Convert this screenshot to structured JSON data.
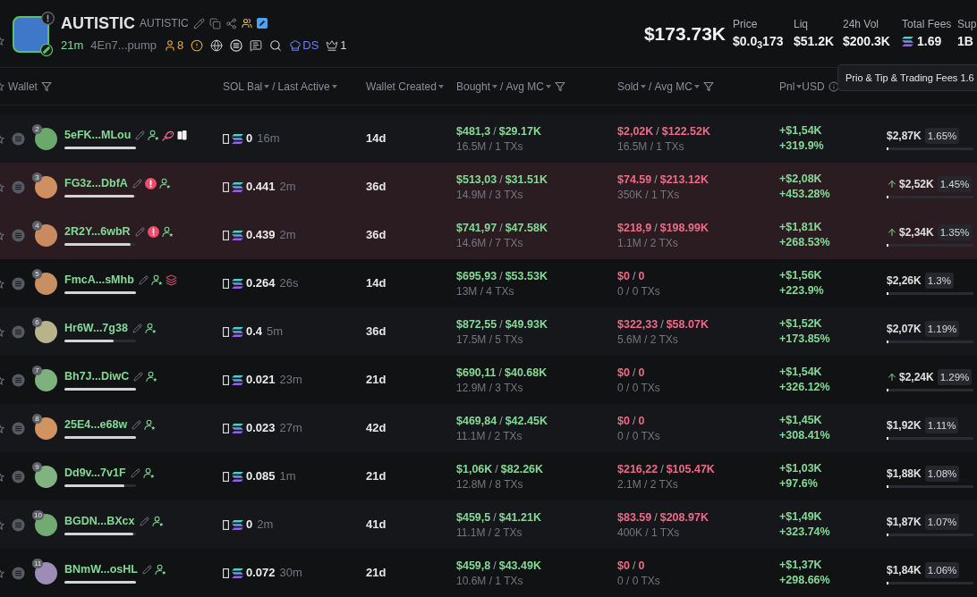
{
  "token": {
    "name": "AUTISTIC",
    "ticker": "AUTISTIC",
    "age": "21m",
    "address": "4En7...pump",
    "holders": "8",
    "dev_label": "DS",
    "crown_count": "1"
  },
  "market_cap": "$173.73K",
  "stats": [
    {
      "label": "Price",
      "value": "$0.0$_{3}$173",
      "kind": "plain"
    },
    {
      "label": "Liq",
      "value": "$51.2K",
      "kind": "plain"
    },
    {
      "label": "24h Vol",
      "value": "$200.3K",
      "kind": "plain"
    },
    {
      "label": "Total Fees",
      "value": "1.69",
      "kind": "sol"
    },
    {
      "label": "Sup",
      "value": "1B",
      "kind": "plain"
    }
  ],
  "tooltip": "Prio & Tip & Trading Fees 1.6",
  "columns": [
    {
      "items": [
        {
          "kind": "label",
          "text": "Wallet"
        },
        {
          "kind": "filter"
        }
      ]
    },
    {
      "items": [
        {
          "kind": "label",
          "text": "SOL Bal"
        },
        {
          "kind": "caret"
        },
        {
          "kind": "separator",
          "text": "/"
        },
        {
          "kind": "label",
          "text": "Last Active"
        },
        {
          "kind": "caret"
        }
      ]
    },
    {
      "items": [
        {
          "kind": "label",
          "text": "Wallet Created"
        },
        {
          "kind": "caret"
        }
      ]
    },
    {
      "items": [
        {
          "kind": "label",
          "text": "Bought"
        },
        {
          "kind": "caret"
        },
        {
          "kind": "separator",
          "text": "/"
        },
        {
          "kind": "label",
          "text": "Avg MC"
        },
        {
          "kind": "caret"
        },
        {
          "kind": "filter"
        }
      ]
    },
    {
      "items": [
        {
          "kind": "label",
          "text": "Sold"
        },
        {
          "kind": "caret"
        },
        {
          "kind": "separator",
          "text": "/"
        },
        {
          "kind": "label",
          "text": "Avg MC"
        },
        {
          "kind": "caret"
        },
        {
          "kind": "filter"
        }
      ]
    },
    {
      "items": [
        {
          "kind": "label",
          "text": "Pnl"
        },
        {
          "kind": "caret"
        },
        {
          "kind": "label",
          "text": "USD"
        },
        {
          "kind": "info"
        }
      ]
    }
  ],
  "rows": [
    {
      "avatar": {
        "rank": "2",
        "color": "#6aa86c"
      },
      "wallet": "5eFK...MLou",
      "tags": [
        {
          "kind": "edit"
        },
        {
          "kind": "tracked"
        },
        {
          "kind": "fish"
        },
        {
          "kind": "cards"
        }
      ],
      "name_bar": {
        "level": 1
      },
      "sol_balance": "0",
      "last_active": "16m",
      "created": "14d",
      "bought": {
        "amount": "$481,3",
        "separator": "/",
        "avg_mc": "$29.17K",
        "detail": "16.5M / 1 TXs"
      },
      "sold": {
        "amount": "$2,02K",
        "separator": "/",
        "avg_mc": "$122.52K",
        "detail": "16.5M / 1 TXs"
      },
      "pnl": {
        "usd": "+$1,54K",
        "percent": "+319.9%"
      },
      "share": {
        "trend_up": false,
        "value": "$2,87K",
        "percent": "1.65%",
        "level": 0.02
      },
      "highlighted": false
    },
    {
      "avatar": {
        "rank": "3",
        "color": "#cf8f60"
      },
      "wallet": "FG3z...DbfA",
      "tags": [
        {
          "kind": "edit"
        },
        {
          "kind": "alert"
        },
        {
          "kind": "tracked"
        }
      ],
      "name_bar": {
        "level": 0.97
      },
      "sol_balance": "0.441",
      "last_active": "2m",
      "created": "36d",
      "bought": {
        "amount": "$513,03",
        "separator": "/",
        "avg_mc": "$31.51K",
        "detail": "14.9M / 3 TXs"
      },
      "sold": {
        "amount": "$74.59",
        "separator": "/",
        "avg_mc": "$213.12K",
        "detail": "350K / 1 TXs"
      },
      "pnl": {
        "usd": "+$2,08K",
        "percent": "+453.28%"
      },
      "share": {
        "trend_up": true,
        "value": "$2,52K",
        "percent": "1.45%",
        "level": 0.02
      },
      "highlighted": true
    },
    {
      "avatar": {
        "rank": "4",
        "color": "#c98a5f"
      },
      "wallet": "2R2Y...6wbR",
      "tags": [
        {
          "kind": "edit"
        },
        {
          "kind": "alert"
        },
        {
          "kind": "tracked"
        }
      ],
      "name_bar": {
        "level": 0.92
      },
      "sol_balance": "0.439",
      "last_active": "2m",
      "created": "36d",
      "bought": {
        "amount": "$741,97",
        "separator": "/",
        "avg_mc": "$47.58K",
        "detail": "14.6M / 7 TXs"
      },
      "sold": {
        "amount": "$218,9",
        "separator": "/",
        "avg_mc": "$198.99K",
        "detail": "1.1M / 2 TXs"
      },
      "pnl": {
        "usd": "+$1,81K",
        "percent": "+268.53%"
      },
      "share": {
        "trend_up": true,
        "value": "$2,34K",
        "percent": "1.35%",
        "level": 0.02
      },
      "highlighted": true
    },
    {
      "avatar": {
        "rank": "5",
        "color": "#c78f62"
      },
      "wallet": "FmcA...sMhb",
      "tags": [
        {
          "kind": "edit"
        },
        {
          "kind": "tracked"
        },
        {
          "kind": "layers"
        }
      ],
      "name_bar": {
        "level": 1
      },
      "sol_balance": "0.264",
      "last_active": "26s",
      "created": "14d",
      "bought": {
        "amount": "$695,93",
        "separator": "/",
        "avg_mc": "$53.53K",
        "detail": "13M / 4 TXs"
      },
      "sold": {
        "amount": "$0",
        "separator": "/",
        "avg_mc": "0",
        "detail": "0 / 0 TXs"
      },
      "pnl": {
        "usd": "+$1,56K",
        "percent": "+223.9%"
      },
      "share": {
        "trend_up": false,
        "value": "$2,26K",
        "percent": "1.3%",
        "level": 0.02
      },
      "highlighted": false
    },
    {
      "avatar": {
        "rank": "6",
        "color": "#b9b38c"
      },
      "wallet": "Hr6W...7g38",
      "tags": [
        {
          "kind": "edit"
        },
        {
          "kind": "tracked"
        }
      ],
      "name_bar": {
        "level": 0.69
      },
      "sol_balance": "0.4",
      "last_active": "5m",
      "created": "36d",
      "bought": {
        "amount": "$872,55",
        "separator": "/",
        "avg_mc": "$49.93K",
        "detail": "17.5M / 5 TXs"
      },
      "sold": {
        "amount": "$322,33",
        "separator": "/",
        "avg_mc": "$58.07K",
        "detail": "5.6M / 2 TXs"
      },
      "pnl": {
        "usd": "+$1,52K",
        "percent": "+173.85%"
      },
      "share": {
        "trend_up": false,
        "value": "$2,07K",
        "percent": "1.19%",
        "level": 0.02
      },
      "highlighted": false
    },
    {
      "avatar": {
        "rank": "7",
        "color": "#7db27f"
      },
      "wallet": "Bh7J...DiwC",
      "tags": [
        {
          "kind": "edit"
        },
        {
          "kind": "tracked"
        }
      ],
      "name_bar": {
        "level": 1
      },
      "sol_balance": "0.021",
      "last_active": "23m",
      "created": "21d",
      "bought": {
        "amount": "$690,11",
        "separator": "/",
        "avg_mc": "$40.68K",
        "detail": "12.9M / 3 TXs"
      },
      "sold": {
        "amount": "$0",
        "separator": "/",
        "avg_mc": "0",
        "detail": "0 / 0 TXs"
      },
      "pnl": {
        "usd": "+$1,54K",
        "percent": "+326.12%"
      },
      "share": {
        "trend_up": true,
        "value": "$2,24K",
        "percent": "1.29%",
        "level": 0.02
      },
      "highlighted": false
    },
    {
      "avatar": {
        "rank": "8",
        "color": "#d19362"
      },
      "wallet": "25E4...e68w",
      "tags": [
        {
          "kind": "edit"
        },
        {
          "kind": "tracked"
        }
      ],
      "name_bar": {
        "level": 1
      },
      "sol_balance": "0.023",
      "last_active": "27m",
      "created": "42d",
      "bought": {
        "amount": "$469,84",
        "separator": "/",
        "avg_mc": "$42.45K",
        "detail": "11.1M / 2 TXs"
      },
      "sold": {
        "amount": "$0",
        "separator": "/",
        "avg_mc": "0",
        "detail": "0 / 0 TXs"
      },
      "pnl": {
        "usd": "+$1,45K",
        "percent": "+308.41%"
      },
      "share": {
        "trend_up": false,
        "value": "$1,92K",
        "percent": "1.11%",
        "level": 0.02
      },
      "highlighted": false
    },
    {
      "avatar": {
        "rank": "9",
        "color": "#80b380"
      },
      "wallet": "Dd9v...7v1F",
      "tags": [
        {
          "kind": "edit"
        },
        {
          "kind": "tracked"
        }
      ],
      "name_bar": {
        "level": 0.84
      },
      "sol_balance": "0.085",
      "last_active": "1m",
      "created": "21d",
      "bought": {
        "amount": "$1,06K",
        "separator": "/",
        "avg_mc": "$82.26K",
        "detail": "12.8M / 8 TXs"
      },
      "sold": {
        "amount": "$216,22",
        "separator": "/",
        "avg_mc": "$105.47K",
        "detail": "2.1M / 2 TXs"
      },
      "pnl": {
        "usd": "+$1,03K",
        "percent": "+97.6%"
      },
      "share": {
        "trend_up": false,
        "value": "$1,88K",
        "percent": "1.08%",
        "level": 0.02
      },
      "highlighted": false
    },
    {
      "avatar": {
        "rank": "10",
        "color": "#72aa72"
      },
      "wallet": "BGDN...BXcx",
      "tags": [
        {
          "kind": "edit"
        },
        {
          "kind": "tracked"
        }
      ],
      "name_bar": {
        "level": 0.96
      },
      "sol_balance": "0",
      "last_active": "2m",
      "created": "41d",
      "bought": {
        "amount": "$459,5",
        "separator": "/",
        "avg_mc": "$41.21K",
        "detail": "11.1M / 2 TXs"
      },
      "sold": {
        "amount": "$83.59",
        "separator": "/",
        "avg_mc": "$208.97K",
        "detail": "400K / 1 TXs"
      },
      "pnl": {
        "usd": "+$1,49K",
        "percent": "+323.74%"
      },
      "share": {
        "trend_up": false,
        "value": "$1,87K",
        "percent": "1.07%",
        "level": 0.02
      },
      "highlighted": false
    },
    {
      "avatar": {
        "rank": "11",
        "color": "#9c8cb6"
      },
      "wallet": "BNmW...osHL",
      "tags": [
        {
          "kind": "edit"
        },
        {
          "kind": "tracked"
        }
      ],
      "name_bar": {
        "level": 1
      },
      "sol_balance": "0.072",
      "last_active": "30m",
      "created": "21d",
      "bought": {
        "amount": "$459,8",
        "separator": "/",
        "avg_mc": "$43.49K",
        "detail": "10.6M / 1 TXs"
      },
      "sold": {
        "amount": "$0",
        "separator": "/",
        "avg_mc": "0",
        "detail": "0 / 0 TXs"
      },
      "pnl": {
        "usd": "+$1,37K",
        "percent": "+298.66%"
      },
      "share": {
        "trend_up": false,
        "value": "$1,84K",
        "percent": "1.06%",
        "level": 0.02
      },
      "highlighted": false
    }
  ]
}
